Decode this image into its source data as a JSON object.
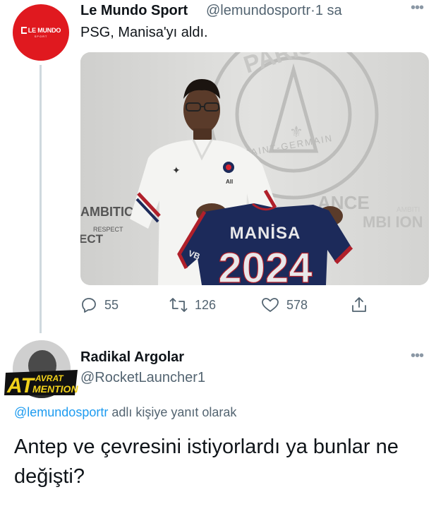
{
  "tweet": {
    "author_name": "Le Mundo Sport",
    "handle": "@lemundosportr",
    "separator": "·",
    "time": "1 sa",
    "text": "PSG, Manisa'yı aldı.",
    "avatar_logo_text": "LE MUNDO",
    "avatar_logo_sub": "SPORT",
    "media": {
      "jersey_name": "MANİSA",
      "jersey_number": "2024",
      "wall_word_left": "AMBITIC",
      "wall_word_left_sub": "RESPECT",
      "wall_word_left_2": "ECT",
      "wall_word_right": "MBI ION",
      "wall_word_right_top": "AMBITI",
      "wall_crest_text": "SAINT-GERMAIN",
      "wall_crest_top": "PARIS",
      "wall_center": "ANCE"
    },
    "actions": {
      "reply_count": "55",
      "retweet_count": "126",
      "like_count": "578"
    },
    "colors": {
      "avatar_bg": "#e0191f",
      "psg_navy": "#1c2a5a"
    }
  },
  "reply": {
    "author_name": "Radikal Argolar",
    "handle": "@RocketLauncher1",
    "badge_at": "AT",
    "badge_line1": "AVRAT",
    "badge_line2": "MENTION",
    "reply_to_mention": "@lemundosportr",
    "reply_to_suffix": " adlı kişiye yanıt olarak",
    "text": "Antep ve çevresini istiyorlardı ya bunlar ne değişti?"
  },
  "icons": [
    "reply-icon",
    "retweet-icon",
    "like-icon",
    "share-icon",
    "more-icon"
  ]
}
